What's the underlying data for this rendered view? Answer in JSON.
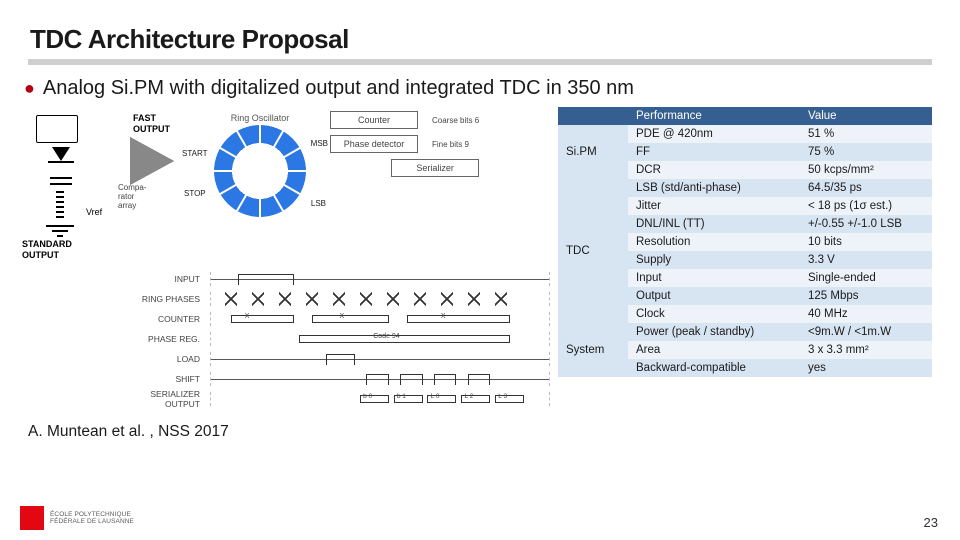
{
  "title": "TDC Architecture Proposal",
  "bullet": "Analog Si.PM with digitalized output and integrated TDC in 350 nm",
  "diagram": {
    "fast_output": "FAST\nOUTPUT",
    "standard_output": "STANDARD\nOUTPUT",
    "vref": "Vref",
    "comparator": "Compa-\nrator\narray",
    "ring_oscillator": "Ring Oscillator",
    "start": "START",
    "stop": "STOP",
    "msb": "MSB",
    "lsb": "LSB",
    "counter": "Counter",
    "phase_detector": "Phase detector",
    "coarse_bits": "Coarse bits",
    "coarse_n": "6",
    "fine_bits": "Fine bits",
    "fine_n": "9",
    "serializer": "Serializer"
  },
  "timing_labels": [
    "INPUT",
    "RING PHASES",
    "COUNTER",
    "PHASE REG.",
    "LOAD",
    "SHIFT",
    "SERIALIZER OUTPUT"
  ],
  "timing_counter_tokens": [
    "X",
    "X",
    "X"
  ],
  "timing_phase_reg_token": "Code 94",
  "timing_serial_tokens": [
    "b 0",
    "b 1",
    "L 0",
    "L 2",
    "L 3"
  ],
  "table": {
    "head": [
      "",
      "Performance",
      "Value"
    ],
    "groups": [
      {
        "name": "Si.PM",
        "rows": [
          [
            "PDE @ 420nm",
            "51 %"
          ],
          [
            "FF",
            "75 %"
          ],
          [
            "DCR",
            "50 kcps/mm²"
          ]
        ]
      },
      {
        "name": "TDC",
        "rows": [
          [
            "LSB (std/anti-phase)",
            "64.5/35 ps"
          ],
          [
            "Jitter",
            "< 18 ps (1σ est.)"
          ],
          [
            "DNL/INL (TT)",
            "+/-0.55   +/-1.0 LSB"
          ],
          [
            "Resolution",
            "10 bits"
          ],
          [
            "Supply",
            "3.3 V"
          ],
          [
            "Input",
            "Single-ended"
          ],
          [
            "Output",
            "125 Mbps"
          ],
          [
            "Clock",
            "40 MHz"
          ]
        ]
      },
      {
        "name": "System",
        "rows": [
          [
            "Power (peak / standby)",
            "<9m.W / <1m.W"
          ],
          [
            "Area",
            "3 x 3.3 mm²"
          ],
          [
            "Backward-compatible",
            "yes"
          ]
        ]
      }
    ]
  },
  "citation": "A. Muntean et al. , NSS 2017",
  "footer": {
    "page": "23",
    "logo_line1": "ÉCOLE POLYTECHNIQUE",
    "logo_line2": "FÉDÉRALE DE LAUSANNE"
  }
}
